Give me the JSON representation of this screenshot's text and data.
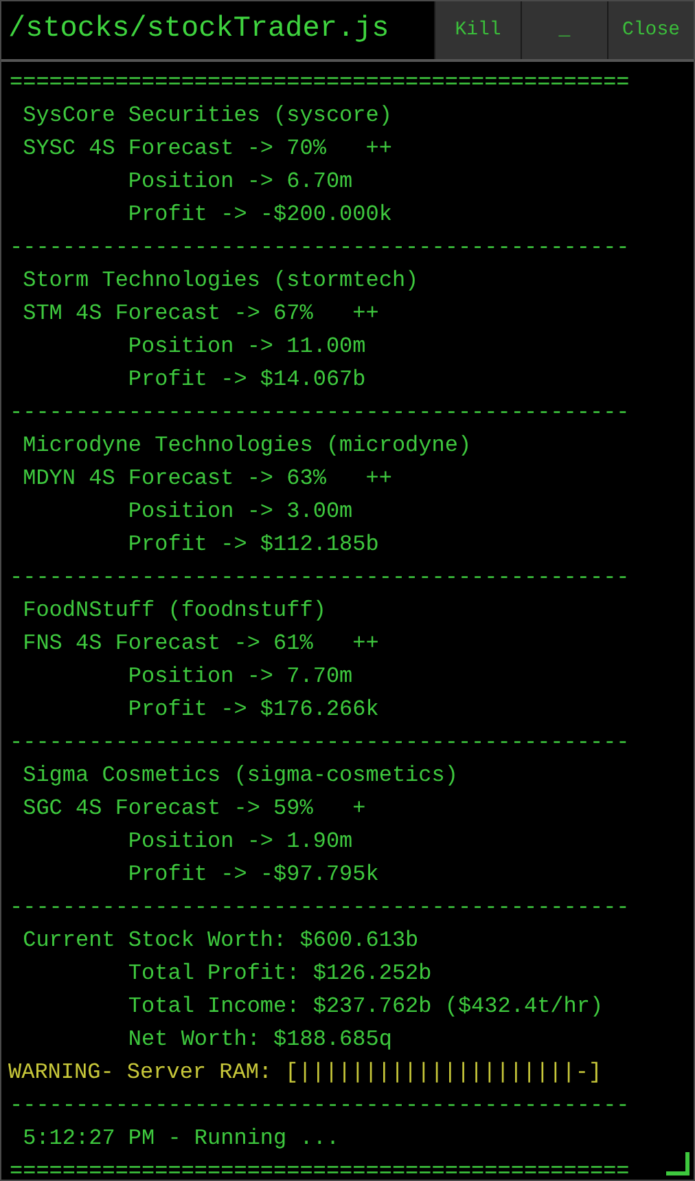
{
  "window": {
    "title": "/stocks/stockTrader.js",
    "buttons": [
      "Kill",
      "_",
      "Close"
    ]
  },
  "log": [
    {
      "kind": "rule",
      "text": "==============================================="
    },
    {
      "kind": "text",
      "text": " SysCore Securities (syscore)"
    },
    {
      "kind": "text",
      "text": " SYSC 4S Forecast -> 70%   ++"
    },
    {
      "kind": "text",
      "text": "         Position -> 6.70m"
    },
    {
      "kind": "text",
      "text": "         Profit -> -$200.000k"
    },
    {
      "kind": "rule",
      "text": "-----------------------------------------------"
    },
    {
      "kind": "text",
      "text": " Storm Technologies (stormtech)"
    },
    {
      "kind": "text",
      "text": " STM 4S Forecast -> 67%   ++"
    },
    {
      "kind": "text",
      "text": "         Position -> 11.00m"
    },
    {
      "kind": "text",
      "text": "         Profit -> $14.067b"
    },
    {
      "kind": "rule",
      "text": "-----------------------------------------------"
    },
    {
      "kind": "text",
      "text": " Microdyne Technologies (microdyne)"
    },
    {
      "kind": "text",
      "text": " MDYN 4S Forecast -> 63%   ++"
    },
    {
      "kind": "text",
      "text": "         Position -> 3.00m"
    },
    {
      "kind": "text",
      "text": "         Profit -> $112.185b"
    },
    {
      "kind": "rule",
      "text": "-----------------------------------------------"
    },
    {
      "kind": "text",
      "text": " FoodNStuff (foodnstuff)"
    },
    {
      "kind": "text",
      "text": " FNS 4S Forecast -> 61%   ++"
    },
    {
      "kind": "text",
      "text": "         Position -> 7.70m"
    },
    {
      "kind": "text",
      "text": "         Profit -> $176.266k"
    },
    {
      "kind": "rule",
      "text": "-----------------------------------------------"
    },
    {
      "kind": "text",
      "text": " Sigma Cosmetics (sigma-cosmetics)"
    },
    {
      "kind": "text",
      "text": " SGC 4S Forecast -> 59%   +"
    },
    {
      "kind": "text",
      "text": "         Position -> 1.90m"
    },
    {
      "kind": "text",
      "text": "         Profit -> -$97.795k"
    },
    {
      "kind": "rule",
      "text": "-----------------------------------------------"
    },
    {
      "kind": "text",
      "text": " Current Stock Worth: $600.613b"
    },
    {
      "kind": "text",
      "text": "         Total Profit: $126.252b"
    },
    {
      "kind": "text",
      "text": "         Total Income: $237.762b ($432.4t/hr)"
    },
    {
      "kind": "text",
      "text": "         Net Worth: $188.685q"
    },
    {
      "kind": "warning",
      "text": "WARNING- Server RAM: [|||||||||||||||||||||-]"
    },
    {
      "kind": "rule",
      "text": "-----------------------------------------------"
    },
    {
      "kind": "text",
      "text": " 5:12:27 PM - Running ..."
    },
    {
      "kind": "rule",
      "text": "==============================================="
    }
  ]
}
